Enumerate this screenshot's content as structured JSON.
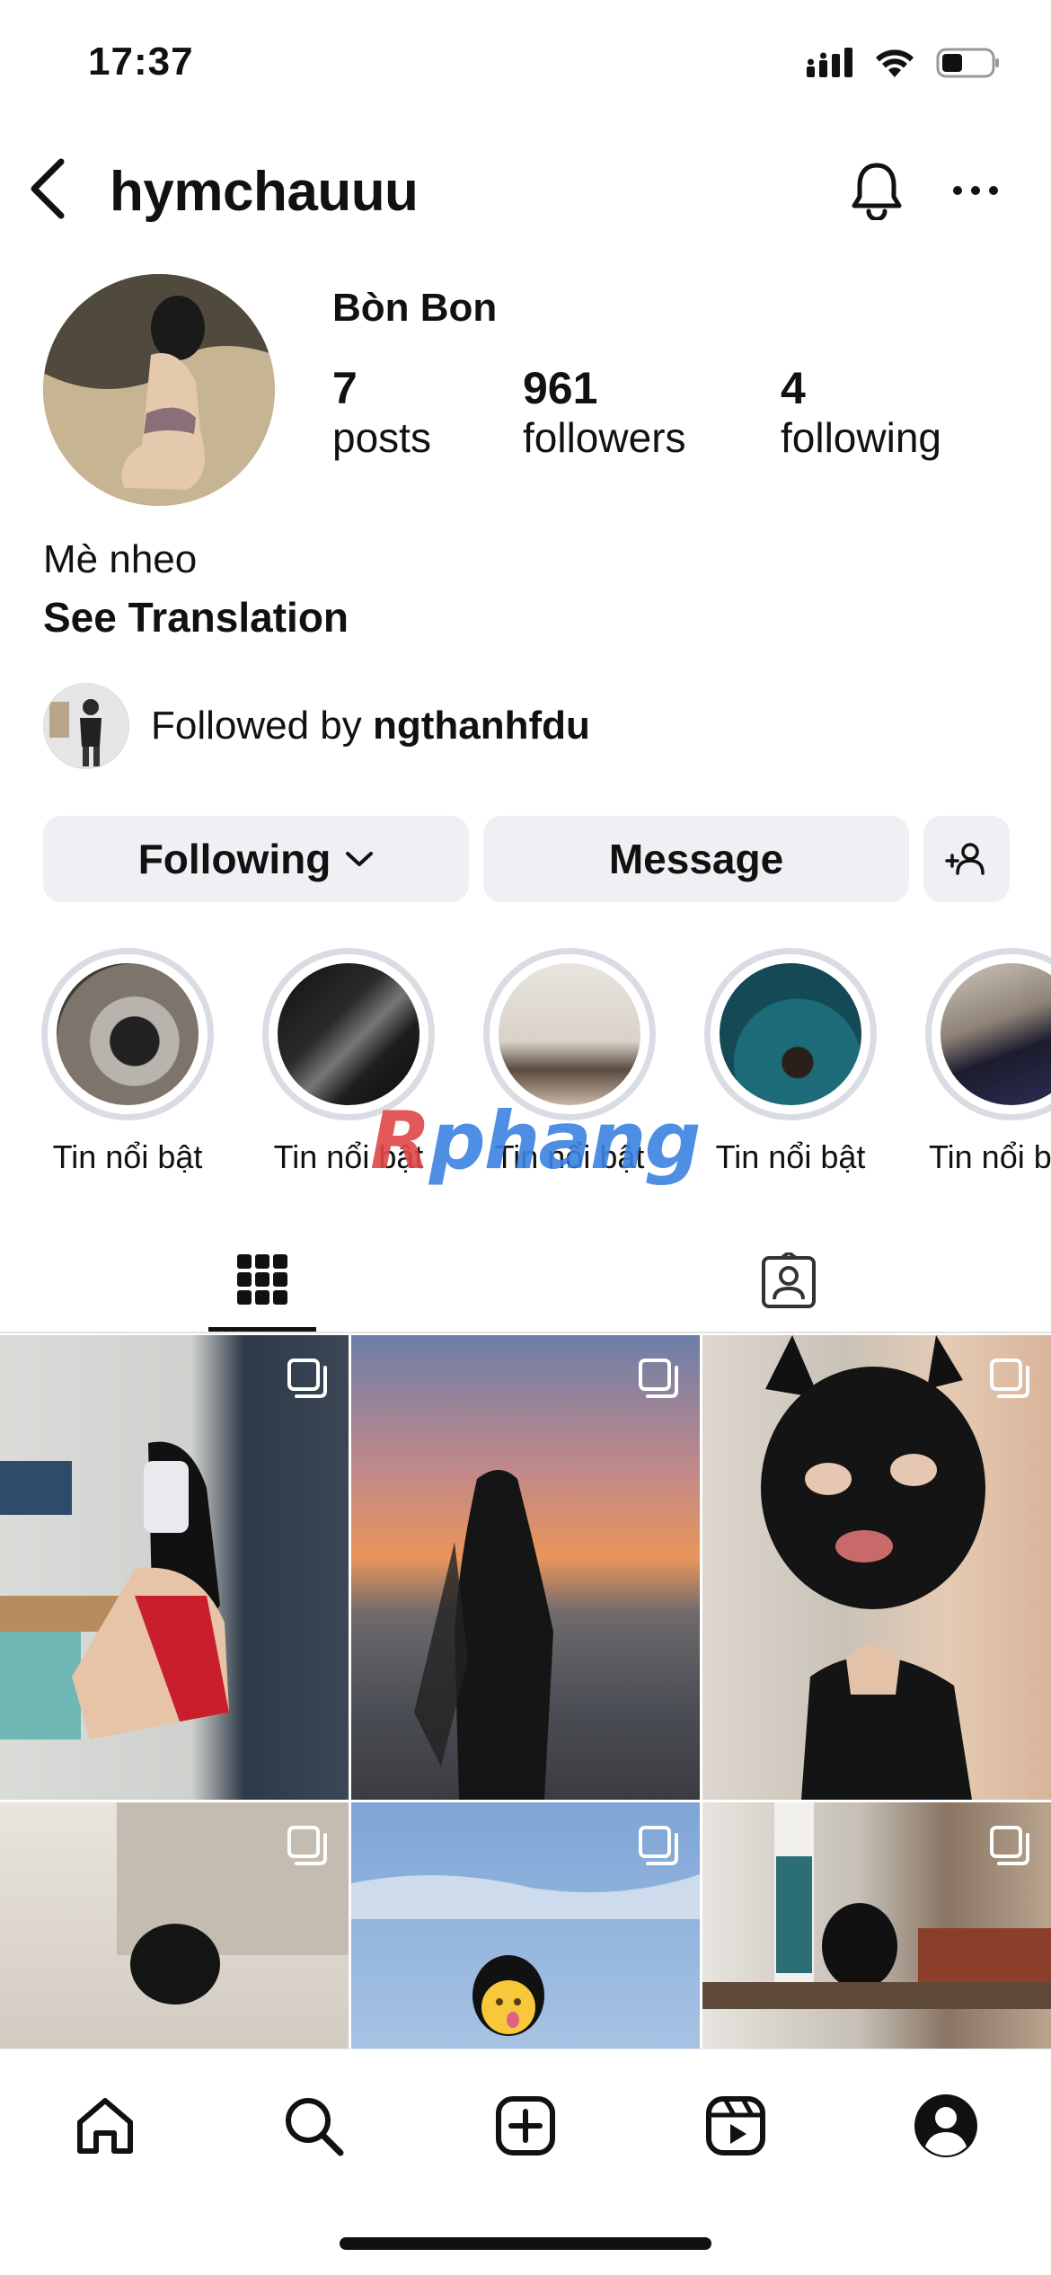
{
  "status_bar": {
    "time": "17:37",
    "icons": [
      "signal-icon",
      "wifi-icon",
      "battery-icon"
    ]
  },
  "header": {
    "username": "hymchauuu",
    "icons": [
      "back-icon",
      "bell-icon",
      "more-icon"
    ]
  },
  "profile": {
    "display_name": "Bòn Bon",
    "stats": [
      {
        "count": "7",
        "label": "posts"
      },
      {
        "count": "961",
        "label": "followers"
      },
      {
        "count": "4",
        "label": "following"
      }
    ],
    "bio": "Mè nheo",
    "see_translation": "See Translation",
    "followed_by_prefix": "Followed by ",
    "followed_by_user": "ngthanhfdu"
  },
  "actions": {
    "following_label": "Following",
    "message_label": "Message",
    "add_person_icon": "add-person-icon"
  },
  "highlights": [
    {
      "label": "Tin nổi bật"
    },
    {
      "label": "Tin nổi bật"
    },
    {
      "label": "Tin nổi bật"
    },
    {
      "label": "Tin nổi bật"
    },
    {
      "label": "Tin nổi b"
    }
  ],
  "watermark": {
    "first": "R",
    "rest": "phang"
  },
  "tabs": [
    {
      "icon": "grid-icon",
      "active": true
    },
    {
      "icon": "tagged-icon",
      "active": false
    }
  ],
  "bottom_nav": [
    "home-icon",
    "search-icon",
    "create-icon",
    "reels-icon",
    "profile-icon"
  ]
}
